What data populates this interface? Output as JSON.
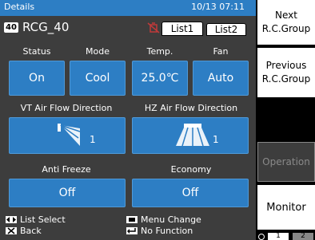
{
  "titlebar": {
    "title": "Details",
    "datetime": "10/13 07:11"
  },
  "group": {
    "number": "40",
    "name": "RCG_40"
  },
  "tabs": {
    "list1": "List1",
    "list2": "List2"
  },
  "labels": {
    "status": "Status",
    "mode": "Mode",
    "temp": "Temp.",
    "fan": "Fan",
    "vt_air": "VT Air Flow Direction",
    "hz_air": "HZ Air Flow Direction",
    "anti_freeze": "Anti Freeze",
    "economy": "Economy"
  },
  "values": {
    "status": "On",
    "mode": "Cool",
    "temp": "25.0℃",
    "fan": "Auto",
    "vt_air": "1",
    "hz_air": "1",
    "anti_freeze": "Off",
    "economy": "Off"
  },
  "hints": {
    "list_select": "List Select",
    "back": "Back",
    "menu_change": "Menu Change",
    "no_function": "No Function"
  },
  "side": {
    "next": [
      "Next",
      "R.C.Group"
    ],
    "previous": [
      "Previous",
      "R.C.Group"
    ],
    "operation": "Operation",
    "monitor": "Monitor",
    "page1": "1",
    "page2": "2"
  },
  "colors": {
    "accent": "#2d7ec4",
    "background": "#3d3d3d"
  }
}
